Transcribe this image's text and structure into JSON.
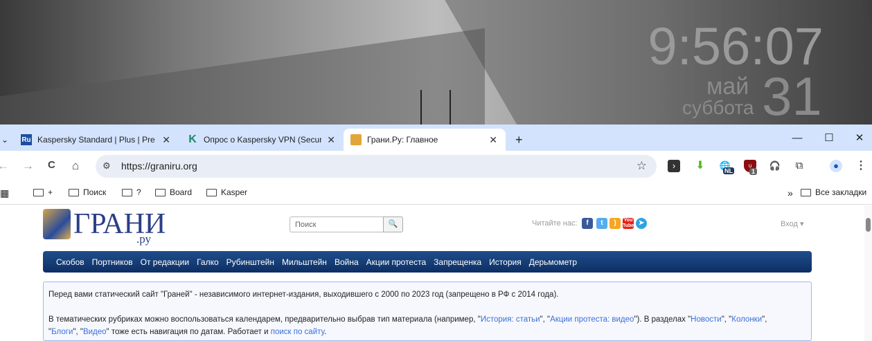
{
  "desktop": {
    "time": "9:56:07",
    "month": "май",
    "weekday": "суббота",
    "day": "31"
  },
  "tabs": [
    {
      "favicon": "Ru",
      "title": "Kaspersky Standard | Plus | Prem",
      "close": "✕"
    },
    {
      "favicon": "K",
      "title": "Опрос о Kaspersky VPN (Secure",
      "close": "✕"
    },
    {
      "favicon": "cube",
      "title": "Грани.Ру: Главное",
      "close": "✕"
    }
  ],
  "new_tab": "+",
  "window": {
    "minimize": "—",
    "maximize": "☐",
    "close": "✕"
  },
  "toolbar": {
    "back": "←",
    "forward": "→",
    "reload": "C",
    "home": "⌂",
    "url": "https://graniru.org",
    "star": "☆",
    "menu": "⋮"
  },
  "extensions": {
    "nl_badge": "NL",
    "ub_badge": "1"
  },
  "bookmarks": {
    "items": [
      "+",
      "Поиск",
      "?",
      "Board",
      "Kasper"
    ],
    "more": "»",
    "all": "Все закладки"
  },
  "site": {
    "logo": "ГРАНИ",
    "logo_sub": ".ру",
    "search_placeholder": "Поиск",
    "read_us": "Читайте нас:",
    "login": "Вход ▾",
    "nav": [
      "Скобов",
      "Портников",
      "От редакции",
      "Галко",
      "Рубинштейн",
      "Мильштейн",
      "Война",
      "Акции протеста",
      "Запрещенка",
      "История",
      "Дерьмометр"
    ],
    "info": {
      "p1": "Перед вами статический сайт \"Граней\" - независимого интернет-издания, выходившего с 2000 по 2023 год (запрещено в РФ с 2014 года).",
      "p2a": "В тематических рубриках можно воспользоваться календарем, предварительно выбрав тип материала (например, \"",
      "l1": "История: статьи",
      "s1": "\", \"",
      "l2": "Акции протеста: видео",
      "s2": "\"). В разделах \"",
      "l3": "Новости",
      "s3": "\", \"",
      "l4": "Колонки",
      "s4": "\",",
      "s5": "\"",
      "l5": "Блоги",
      "s6": "\", \"",
      "l6": "Видео",
      "s7": "\" тоже есть навигация по датам. Работает и ",
      "l7": "поиск по сайту",
      "s8": "."
    }
  }
}
